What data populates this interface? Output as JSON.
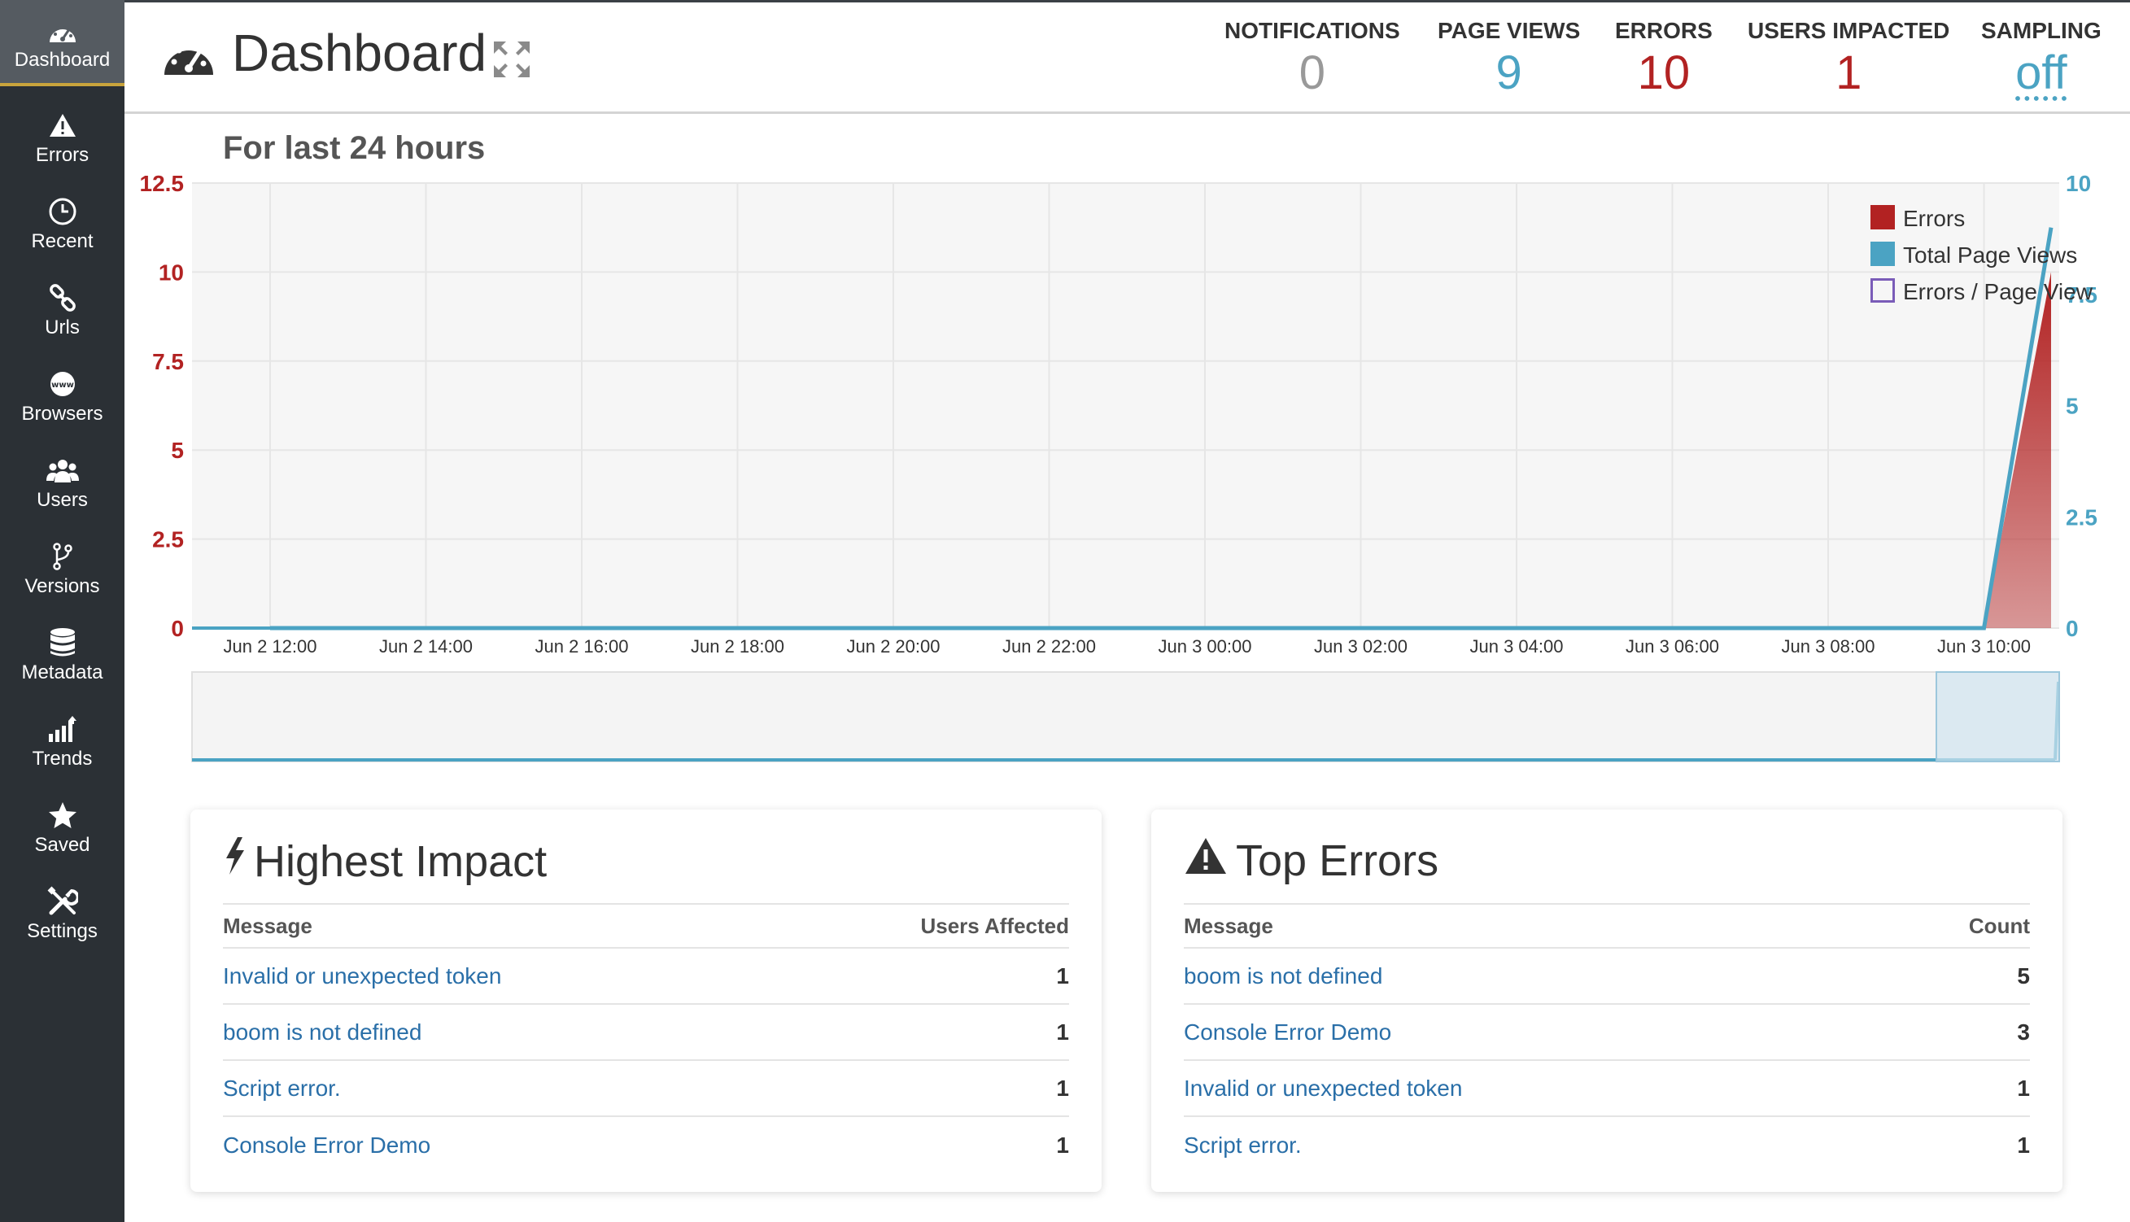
{
  "nav": [
    {
      "label": "Dashboard",
      "icon": "dashboard-icon",
      "active": true
    },
    {
      "label": "Errors",
      "icon": "warning-icon"
    },
    {
      "label": "Recent",
      "icon": "clock-icon"
    },
    {
      "label": "Urls",
      "icon": "link-icon"
    },
    {
      "label": "Browsers",
      "icon": "www-icon"
    },
    {
      "label": "Users",
      "icon": "users-icon"
    },
    {
      "label": "Versions",
      "icon": "branch-icon"
    },
    {
      "label": "Metadata",
      "icon": "database-icon"
    },
    {
      "label": "Trends",
      "icon": "trends-icon"
    },
    {
      "label": "Saved",
      "icon": "star-icon"
    },
    {
      "label": "Settings",
      "icon": "settings-icon"
    }
  ],
  "header": {
    "title": "Dashboard",
    "stats": [
      {
        "label": "NOTIFICATIONS",
        "value": "0",
        "color": "#999999"
      },
      {
        "label": "PAGE VIEWS",
        "value": "9",
        "color": "#4ba3c3"
      },
      {
        "label": "ERRORS",
        "value": "10",
        "color": "#b22222"
      },
      {
        "label": "USERS IMPACTED",
        "value": "1",
        "color": "#b22222"
      },
      {
        "label": "SAMPLING",
        "value": "off",
        "color": "#4ba3c3"
      }
    ]
  },
  "subtitle": "For last 24 hours",
  "chart_data": {
    "type": "area",
    "x": [
      "Jun 2 12:00",
      "Jun 2 14:00",
      "Jun 2 16:00",
      "Jun 2 18:00",
      "Jun 2 20:00",
      "Jun 2 22:00",
      "Jun 3 00:00",
      "Jun 3 02:00",
      "Jun 3 04:00",
      "Jun 3 06:00",
      "Jun 3 08:00",
      "Jun 3 10:00",
      "Jun 3 11:00"
    ],
    "y_left_ticks": [
      "0",
      "2.5",
      "5",
      "7.5",
      "10",
      "12.5"
    ],
    "y_left_lim": [
      0,
      12.5
    ],
    "y_right_ticks": [
      "0",
      "2.5",
      "5",
      "7.5",
      "10"
    ],
    "y_right_lim": [
      0,
      10
    ],
    "series": [
      {
        "name": "Errors",
        "axis": "left",
        "color": "#b22222",
        "values": [
          0,
          0,
          0,
          0,
          0,
          0,
          0,
          0,
          0,
          0,
          0,
          0,
          10
        ]
      },
      {
        "name": "Total Page Views",
        "axis": "right",
        "color": "#4ba3c3",
        "values": [
          0,
          0,
          0,
          0,
          0,
          0,
          0,
          0,
          0,
          0,
          0,
          0,
          9
        ]
      },
      {
        "name": "Errors / Page View",
        "axis": "right",
        "color": "#7a5cb8",
        "values": []
      }
    ],
    "legend_position": "top-right",
    "grid": true
  },
  "panels": {
    "impact": {
      "title": "Highest Impact",
      "col1": "Message",
      "col2": "Users Affected",
      "rows": [
        {
          "message": "Invalid or unexpected token",
          "value": "1"
        },
        {
          "message": "boom is not defined",
          "value": "1"
        },
        {
          "message": "Script error.",
          "value": "1"
        },
        {
          "message": "Console Error Demo",
          "value": "1"
        }
      ]
    },
    "errors": {
      "title": "Top Errors",
      "col1": "Message",
      "col2": "Count",
      "rows": [
        {
          "message": "boom is not defined",
          "value": "5"
        },
        {
          "message": "Console Error Demo",
          "value": "3"
        },
        {
          "message": "Invalid or unexpected token",
          "value": "1"
        },
        {
          "message": "Script error.",
          "value": "1"
        }
      ]
    }
  }
}
